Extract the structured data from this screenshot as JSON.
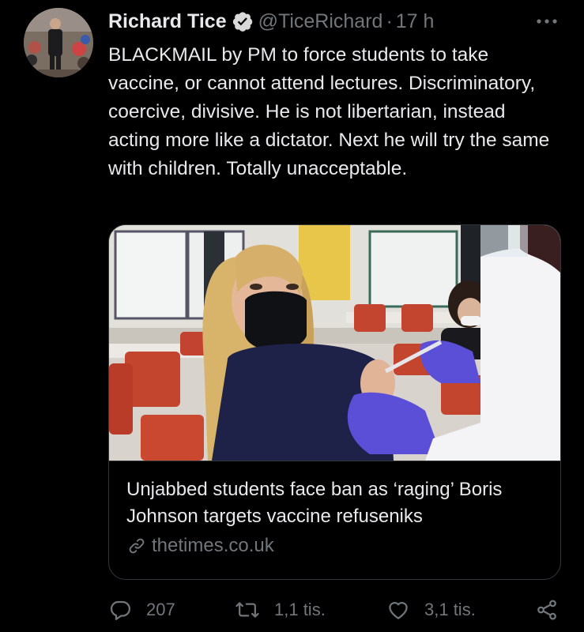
{
  "tweet": {
    "author_name": "Richard Tice",
    "handle": "@TiceRichard",
    "separator": "·",
    "time": "17 h",
    "text": "BLACKMAIL by PM to force students to take vaccine, or cannot attend lectures. Discriminatory, coercive, divisive. He is not libertarian, instead acting more like a dictator. Next he will try the same with children. Totally unacceptable."
  },
  "link_card": {
    "title": "Unjabbed students face ban as ‘raging’ Boris Johnson targets vaccine refuseniks",
    "domain": "thetimes.co.uk"
  },
  "actions": {
    "replies": "207",
    "retweets": "1,1 tis.",
    "likes": "3,1 tis."
  },
  "icons": [
    "verified-badge-icon",
    "more-options-icon",
    "link-icon",
    "reply-icon",
    "retweet-icon",
    "like-icon",
    "share-icon"
  ],
  "colors": {
    "background": "#000000",
    "primary_text": "#e7e9ea",
    "secondary_text": "#71767b",
    "border": "#333639",
    "verified_badge": "#d9d9d9"
  }
}
